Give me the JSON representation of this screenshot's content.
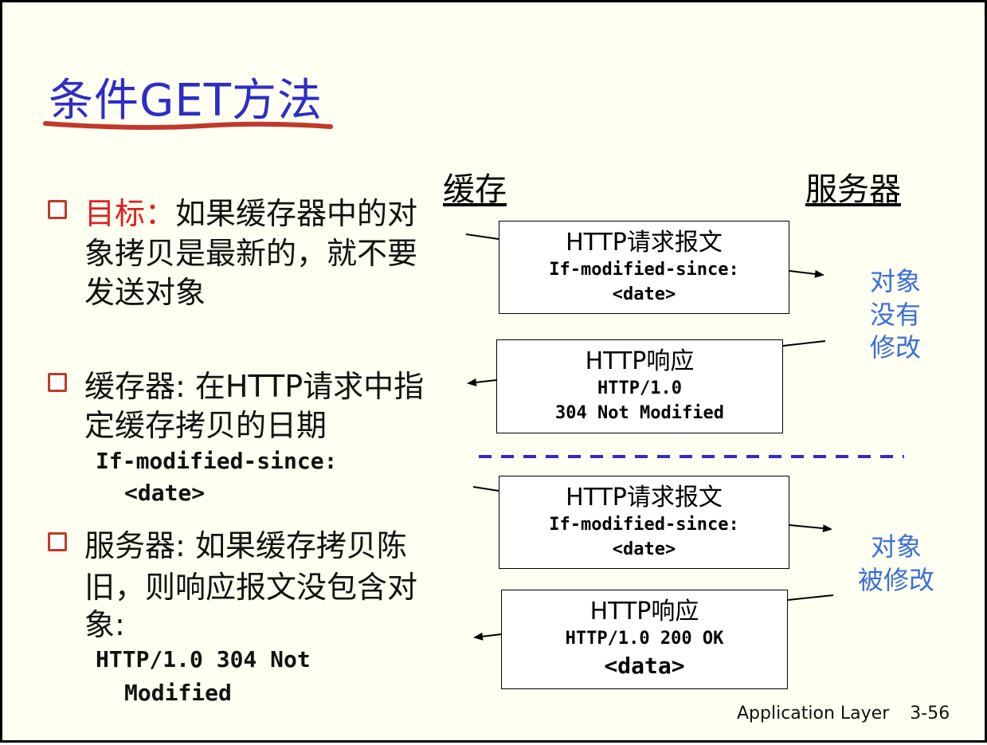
{
  "title": "条件GET方法",
  "columns": {
    "cache": "缓存",
    "server": "服务器"
  },
  "bullets": [
    {
      "label": "目标",
      "separator": "：",
      "lines": [
        "如果缓存器中的对",
        "象拷贝是最新的，就不要",
        "发送对象"
      ]
    },
    {
      "lines": [
        "缓存器: 在HTTP请求中指",
        "定缓存拷贝的日期"
      ],
      "code": [
        "If-modified-since:",
        "<date>"
      ]
    },
    {
      "lines": [
        "服务器: 如果缓存拷贝陈",
        "旧，则响应报文没包含对",
        "象:"
      ],
      "code": [
        "HTTP/1.0 304 Not",
        "Modified"
      ]
    }
  ],
  "messages": {
    "req1": {
      "title": "HTTP请求报文",
      "line1": "If-modified-since:",
      "line2": "<date>"
    },
    "resp1": {
      "title": "HTTP响应",
      "line1": "HTTP/1.0",
      "line2": "304 Not Modified"
    },
    "req2": {
      "title": "HTTP请求报文",
      "line1": "If-modified-since:",
      "line2": "<date>"
    },
    "resp2": {
      "title": "HTTP响应",
      "line1": "HTTP/1.0 200 OK",
      "line2": "<data>"
    }
  },
  "notes": {
    "not_modified": [
      "对象",
      "没有",
      "修改"
    ],
    "modified": [
      "对象",
      "被修改"
    ]
  },
  "footer": {
    "label": "Application Layer",
    "page": "3-56"
  },
  "colors": {
    "title": "#2d2dc8",
    "underline": "#c0392b",
    "highlight": "#e02020",
    "note": "#3a6fd6",
    "divider": "#2d2dc8"
  }
}
